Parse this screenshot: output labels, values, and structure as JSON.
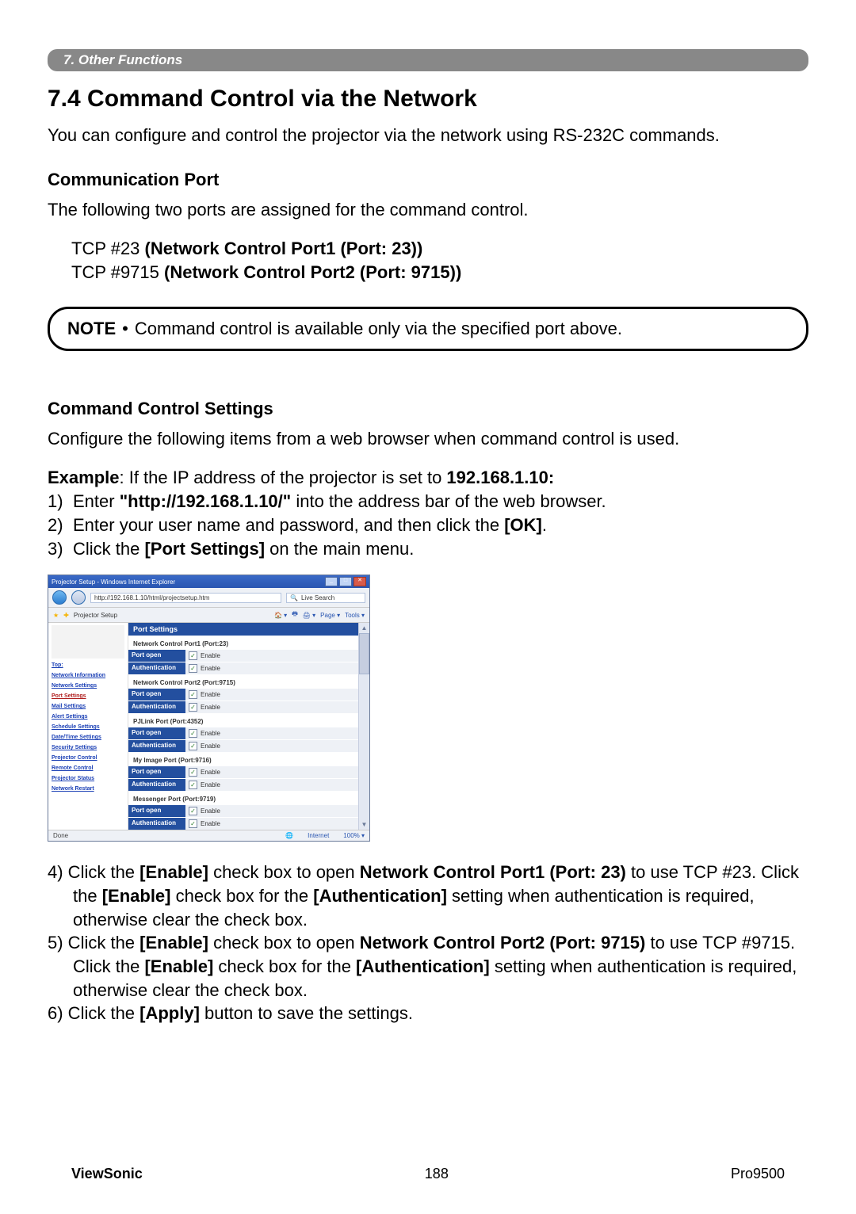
{
  "chapter_bar": "7. Other Functions",
  "section_title": "7.4 Command Control via the Network",
  "intro": "You can configure and control the projector via the network using RS-232C commands.",
  "comm_port": {
    "heading": "Communication Port",
    "lead": "The following two ports are assigned for the command control.",
    "port1_prefix": "TCP #23 ",
    "port1_bold": "(Network Control Port1 (Port: 23))",
    "port2_prefix": "TCP #9715 ",
    "port2_bold": "(Network Control Port2 (Port: 9715))"
  },
  "note": {
    "label": "NOTE",
    "bullet": "•",
    "text": " Command control is available only via the specified port above."
  },
  "cc_settings": {
    "heading": "Command Control Settings",
    "lead": "Configure the following items from a web browser when command control is used.",
    "example_label": "Example",
    "example_text_a": ": If the IP address of the projector is set to ",
    "example_ip": "192.168.1.10:",
    "step1_num": "1)",
    "step1_a": " Enter ",
    "step1_url": "\"http://192.168.1.10/\"",
    "step1_b": " into the address bar of the web browser.",
    "step2_num": "2)",
    "step2_a": " Enter your user name and password, and then click the ",
    "step2_ok": "[OK]",
    "step2_b": ".",
    "step3_num": "3)",
    "step3_a": " Click the ",
    "step3_ps": "[Port Settings]",
    "step3_b": " on the main menu."
  },
  "steps_after": {
    "s4_num": "4)",
    "s4_a": " Click the ",
    "s4_enable": "[Enable]",
    "s4_b": " check box to open ",
    "s4_port": "Network Control Port1 (Port: 23)",
    "s4_c": " to use TCP #23. Click the ",
    "s4_enable2": "[Enable]",
    "s4_d": " check box for the ",
    "s4_auth": "[Authentication]",
    "s4_e": " setting when authentication is required, otherwise clear the check box.",
    "s5_num": "5)",
    "s5_a": " Click the ",
    "s5_enable": "[Enable]",
    "s5_b": " check box to open ",
    "s5_port": "Network Control Port2 (Port: 9715)",
    "s5_c": " to use TCP #9715. Click the ",
    "s5_enable2": "[Enable]",
    "s5_d": " check box for the ",
    "s5_auth": "[Authentication]",
    "s5_e": " setting when authentication is required, otherwise clear the check box.",
    "s6_num": "6)",
    "s6_a": " Click the ",
    "s6_apply": "[Apply]",
    "s6_b": " button to save the settings."
  },
  "screenshot": {
    "titlebar": "Projector Setup - Windows Internet Explorer",
    "url": "http://192.168.1.10/html/projectsetup.htm",
    "search_placeholder": "Live Search",
    "tab": "Projector Setup",
    "tool_page": "Page ▾",
    "tool_tools": "Tools ▾",
    "sidebar": {
      "top": "Top:",
      "items": [
        "Network Information",
        "Network Settings",
        "Port Settings",
        "Mail Settings",
        "Alert Settings",
        "Schedule Settings",
        "Date/Time Settings",
        "Security Settings",
        "Projector Control",
        "Remote Control",
        "Projector Status",
        "Network Restart"
      ]
    },
    "main_title": "Port Settings",
    "groups": [
      {
        "title": "Network Control Port1 (Port:23)",
        "rows": [
          [
            "Port open",
            "Enable"
          ],
          [
            "Authentication",
            "Enable"
          ]
        ]
      },
      {
        "title": "Network Control Port2 (Port:9715)",
        "rows": [
          [
            "Port open",
            "Enable"
          ],
          [
            "Authentication",
            "Enable"
          ]
        ]
      },
      {
        "title": "PJLink Port (Port:4352)",
        "rows": [
          [
            "Port open",
            "Enable"
          ],
          [
            "Authentication",
            "Enable"
          ]
        ]
      },
      {
        "title": "My Image Port (Port:9716)",
        "rows": [
          [
            "Port open",
            "Enable"
          ],
          [
            "Authentication",
            "Enable"
          ]
        ]
      },
      {
        "title": "Messenger Port (Port:9719)",
        "rows": [
          [
            "Port open",
            "Enable"
          ],
          [
            "Authentication",
            "Enable"
          ]
        ]
      }
    ],
    "status_done": "Done",
    "status_internet": "Internet",
    "status_zoom": "100% ▾"
  },
  "footer": {
    "brand": "ViewSonic",
    "page": "188",
    "model": "Pro9500"
  }
}
